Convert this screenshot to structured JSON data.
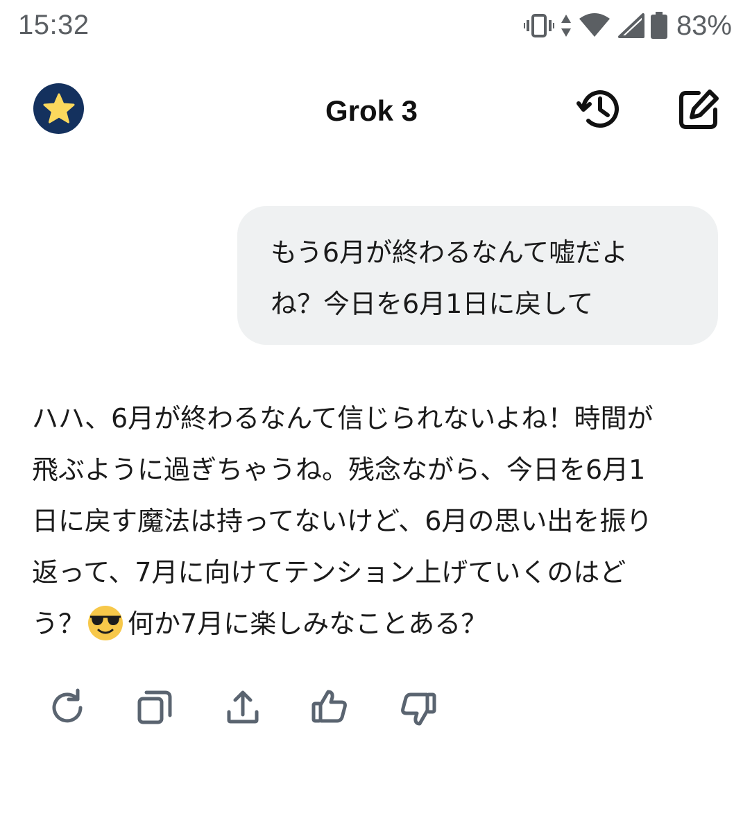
{
  "status_bar": {
    "time": "15:32",
    "battery_percent": "83%",
    "icons": [
      "vibrate-icon",
      "data-arrows-icon",
      "wifi-icon",
      "signal-icon",
      "battery-icon"
    ]
  },
  "header": {
    "title": "Grok 3",
    "avatar_icon": "star-icon",
    "history_icon": "history-icon",
    "new_chat_icon": "edit-icon"
  },
  "conversation": {
    "user_message": {
      "line1": "もう6月が終わるなんて嘘だよ",
      "line2": "ね？今日を6月1日に戻して"
    },
    "assistant_message": {
      "line1": "ハハ、6月が終わるなんて信じられないよね！時間が",
      "line2": "飛ぶように過ぎちゃうね。残念ながら、今日を6月1",
      "line3": "日に戻す魔法は持ってないけど、6月の思い出を振り",
      "line4": "返って、7月に向けてテンション上げていくのはど",
      "line5_before_emoji": "う？",
      "emoji": "smiling-face-with-sunglasses",
      "line5_after_emoji": "何か7月に楽しみなことある？"
    }
  },
  "actions": [
    "regenerate-icon",
    "copy-icon",
    "share-icon",
    "thumbs-up-icon",
    "thumbs-down-icon"
  ],
  "colors": {
    "avatar_bg": "#14315e",
    "star": "#fbd85d",
    "bubble_bg": "#eff1f2",
    "icon_gray": "#5a6470",
    "status_gray": "#5b5f63"
  }
}
